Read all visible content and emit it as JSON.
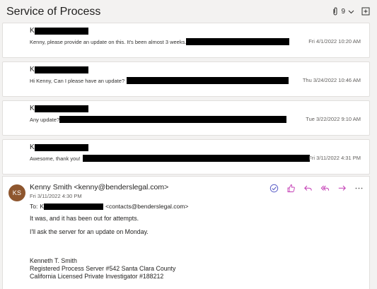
{
  "header": {
    "title": "Service of Process",
    "attachment_count": "9"
  },
  "messages": [
    {
      "sender_initial": "K",
      "preview": "Kenny, please provide an update on this. It's been almost 3 weeks.",
      "date": "Fri 4/1/2022 10:20 AM"
    },
    {
      "sender_initial": "K",
      "preview": "Hi Kenny, Can I please have an update?",
      "date": "Thu 3/24/2022 10:46 AM"
    },
    {
      "sender_initial": "K",
      "preview": "Any update?",
      "date": "Tue 3/22/2022 9:10 AM"
    },
    {
      "sender_initial": "K",
      "preview": "Awesome, thank you!",
      "date": "Fri 3/11/2022 4:31 PM"
    }
  ],
  "open_message": {
    "avatar_initials": "KS",
    "from": "Kenny Smith <kenny@benderslegal.com>",
    "sent": "Fri 3/11/2022 4:30 PM",
    "to_label": "To:",
    "to_initial": "K",
    "to_address": "<contacts@benderslegal.com>",
    "body": [
      "It was, and it has been out for attempts.",
      "I'll ask the server for an update on Monday."
    ],
    "signature": [
      "Kenneth T. Smith",
      "Registered Process Server #542 Santa Clara County",
      "California Licensed Private Investigator #188212"
    ]
  },
  "colors": {
    "accent": "#5b5fc7",
    "action_pink": "#c239b3",
    "avatar_bg": "#8e562e"
  }
}
